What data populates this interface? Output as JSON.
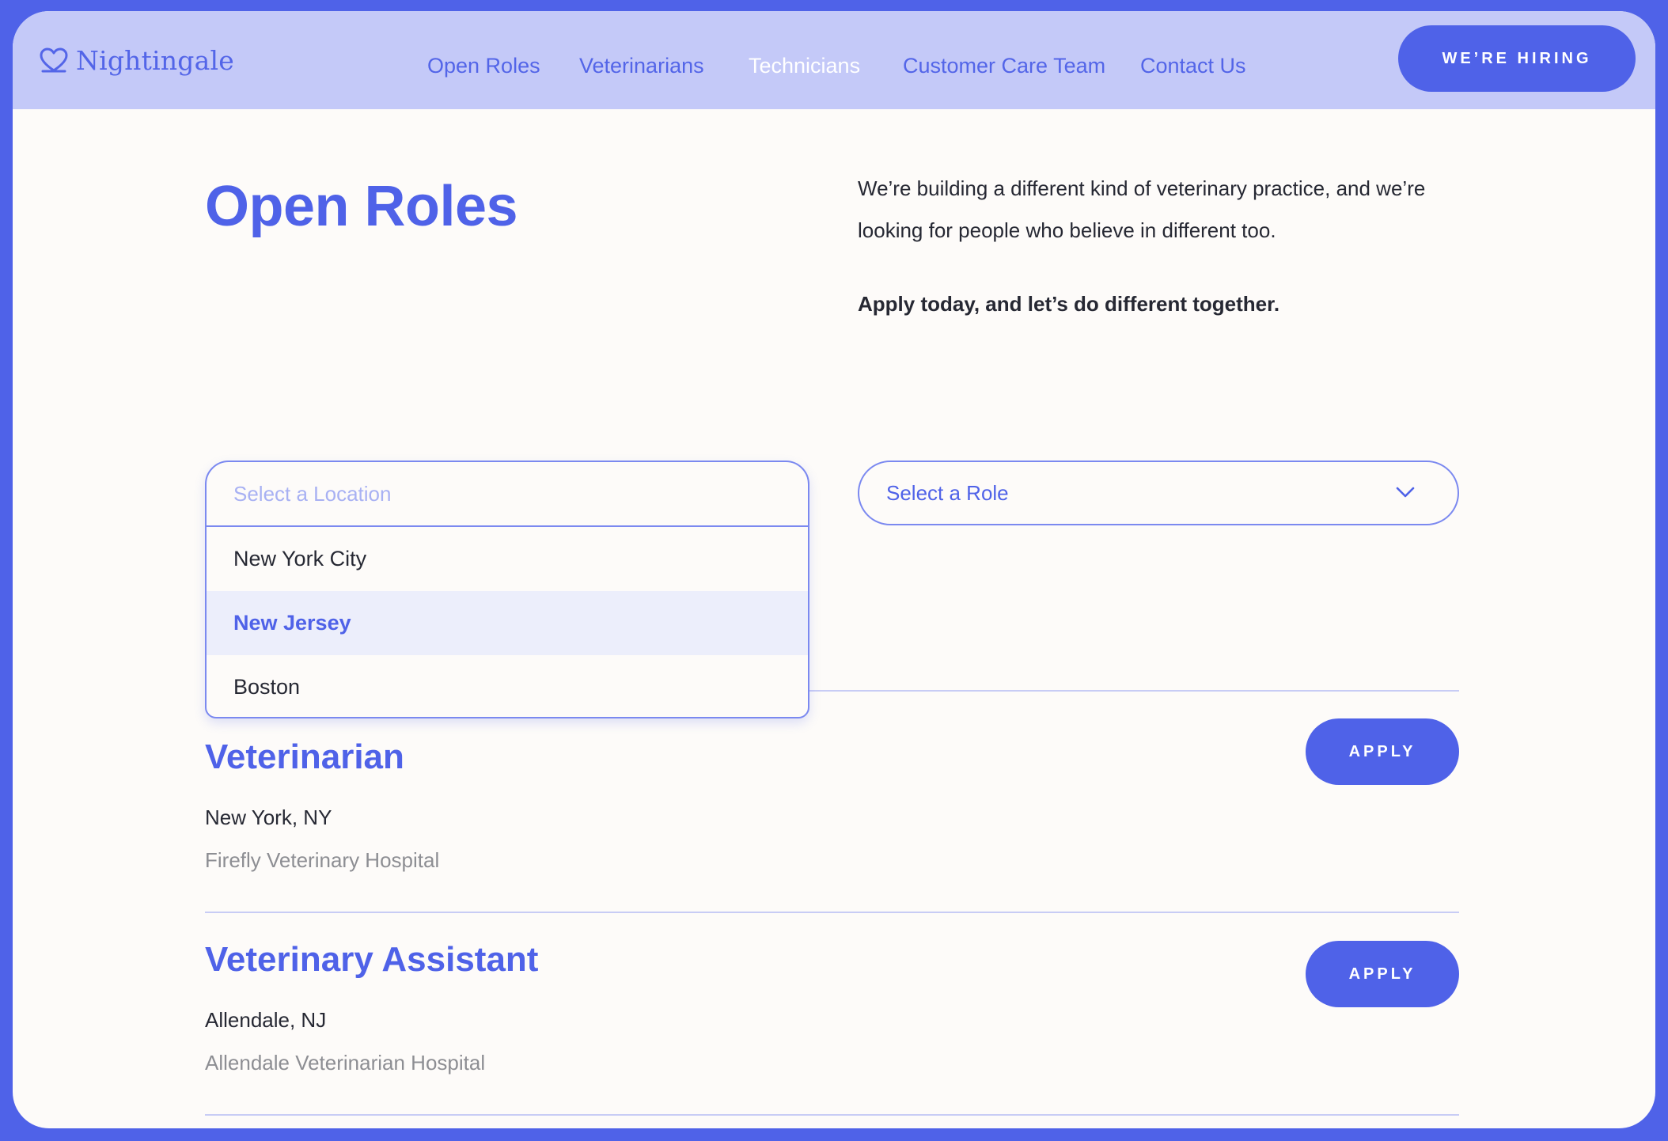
{
  "header": {
    "logo_text": "Nightingale",
    "logo_icon": "heart-icon",
    "nav": [
      {
        "label": "Open Roles"
      },
      {
        "label": "Veterinarians"
      },
      {
        "label": "Technicians"
      },
      {
        "label": "Customer Care Team"
      },
      {
        "label": "Contact Us"
      }
    ],
    "active_nav": "Technicians",
    "hiring_button": "WE’RE HIRING"
  },
  "hero": {
    "title": "Open Roles",
    "intro": "We’re building a different kind of veterinary practice, and we’re looking for people who believe in different too.",
    "cta": "Apply today, and let’s do different together."
  },
  "filters": {
    "location": {
      "placeholder": "Select a Location",
      "options": [
        "New York City",
        "New Jersey",
        "Boston"
      ],
      "highlighted": "New Jersey"
    },
    "role": {
      "placeholder": "Select a Role",
      "icon": "chevron-down-icon"
    }
  },
  "jobs": [
    {
      "title": "Veterinarian",
      "location": "New York, NY",
      "hospital": "Firefly Veterinary Hospital",
      "apply_label": "APPLY"
    },
    {
      "title": "Veterinary Assistant",
      "location": "Allendale, NJ",
      "hospital": "Allendale Veterinarian Hospital",
      "apply_label": "APPLY"
    }
  ],
  "colors": {
    "brand": "#4f62e8",
    "header_bg": "#c4c9f8",
    "page_bg": "#fdfbf9",
    "text": "#262833",
    "muted": "#8d8e93",
    "option_highlight": "#eceefb"
  }
}
